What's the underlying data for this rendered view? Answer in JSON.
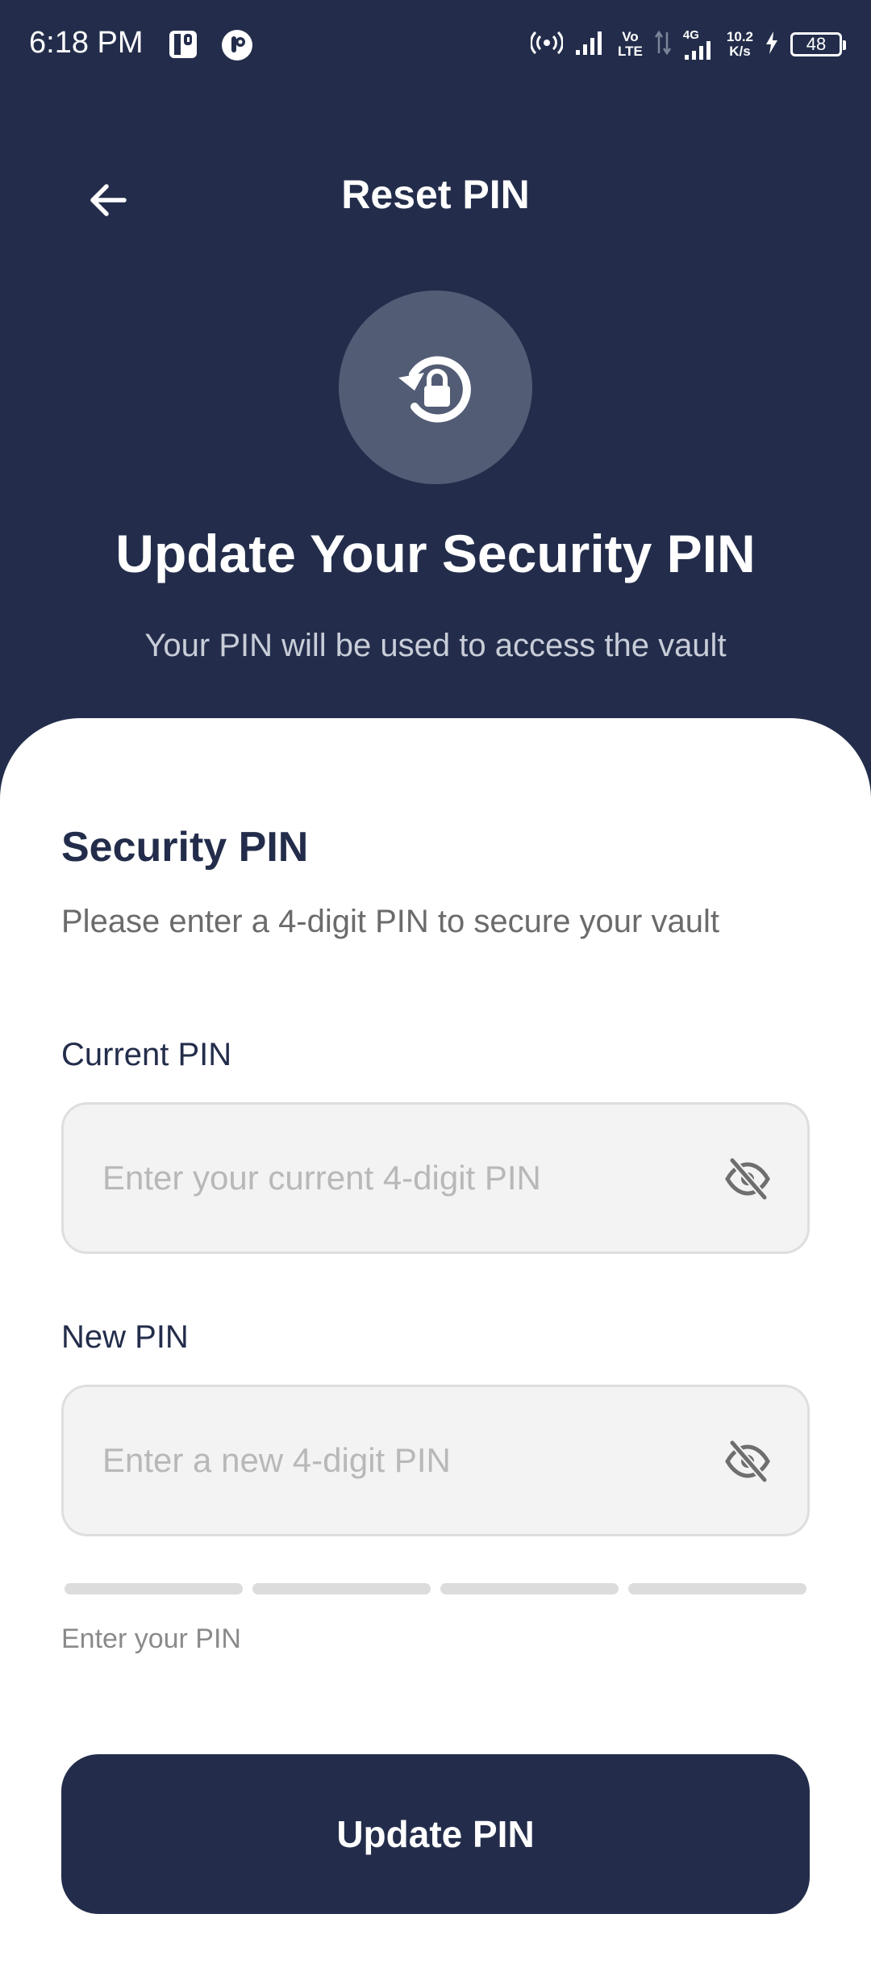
{
  "status_bar": {
    "time": "6:18 PM",
    "network_volte_top": "Vo",
    "network_volte_bottom": "LTE",
    "network_4g": "4G",
    "speed_value": "10.2",
    "speed_unit": "K/s",
    "battery": "48"
  },
  "appbar": {
    "title": "Reset PIN",
    "back_icon": "arrow-left-icon"
  },
  "hero": {
    "icon": "lock-reset-icon",
    "title": "Update Your Security PIN",
    "subtitle": "Your PIN will be used to access the vault"
  },
  "form": {
    "section_title": "Security PIN",
    "section_description": "Please enter a 4-digit PIN to secure your vault",
    "current_pin": {
      "label": "Current PIN",
      "value": "",
      "placeholder": "Enter your current 4-digit PIN",
      "toggle_icon": "eye-off-icon"
    },
    "new_pin": {
      "label": "New PIN",
      "value": "",
      "placeholder": "Enter a new 4-digit PIN",
      "toggle_icon": "eye-off-icon"
    },
    "strength": {
      "filled_segments": 0,
      "total_segments": 4,
      "hint": "Enter your PIN"
    },
    "submit_label": "Update PIN"
  },
  "colors": {
    "header_background": "#232d4b",
    "hero_circle": "#525c74",
    "button_background": "#232d4b",
    "input_background": "#f3f3f3",
    "strength_empty": "#dcdcdc"
  }
}
